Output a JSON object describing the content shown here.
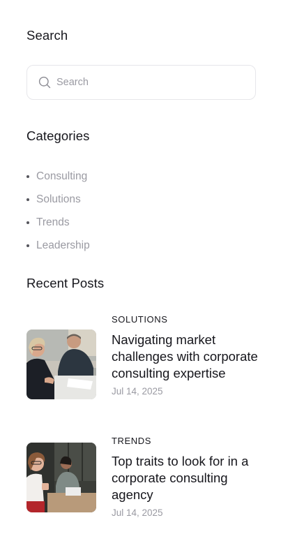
{
  "search": {
    "title": "Search",
    "placeholder": "Search",
    "icon": "search-icon"
  },
  "categories": {
    "title": "Categories",
    "items": [
      {
        "label": "Consulting"
      },
      {
        "label": "Solutions"
      },
      {
        "label": "Trends"
      },
      {
        "label": "Leadership"
      }
    ]
  },
  "recent_posts": {
    "title": "Recent Posts",
    "items": [
      {
        "category": "SOLUTIONS",
        "title": "Navigating market challenges with corporate consulting expertise",
        "date": "Jul 14, 2025"
      },
      {
        "category": "TRENDS",
        "title": "Top traits to look for in a corporate consulting agency",
        "date": "Jul 14, 2025"
      }
    ]
  },
  "colors": {
    "heading": "#16161c",
    "muted": "#9a9aa2",
    "border": "#e6e6ea"
  }
}
